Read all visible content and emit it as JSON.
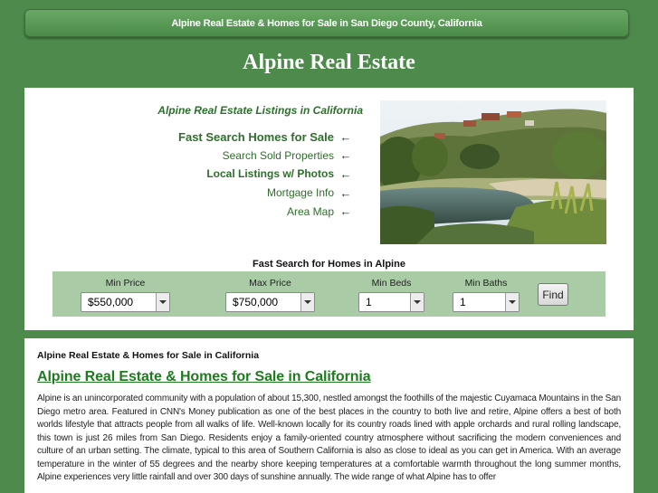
{
  "header": {
    "banner_text": "Alpine Real Estate & Homes for Sale in San Diego County, California",
    "site_title": "Alpine Real Estate"
  },
  "hero": {
    "listing_heading": "Alpine Real Estate Listings in California",
    "nav_links": [
      {
        "label": "Fast Search Homes for Sale",
        "icon": "arrow-left-icon"
      },
      {
        "label": "Search Sold Properties",
        "icon": "arrow-left-icon"
      },
      {
        "label": "Local Listings w/ Photos",
        "icon": "arrow-left-icon"
      },
      {
        "label": "Mortgage Info",
        "icon": "arrow-left-icon"
      },
      {
        "label": "Area Map",
        "icon": "arrow-left-icon"
      }
    ]
  },
  "search": {
    "title": "Fast Search for Homes in Alpine",
    "min_price": {
      "label": "Min Price",
      "value": "$550,000"
    },
    "max_price": {
      "label": "Max Price",
      "value": "$750,000"
    },
    "min_beds": {
      "label": "Min Beds",
      "value": "1"
    },
    "min_baths": {
      "label": "Min Baths",
      "value": "1"
    },
    "find_label": "Find"
  },
  "content": {
    "crumb_heading": "Alpine Real Estate & Homes for Sale in California",
    "main_heading": "Alpine Real Estate & Homes for Sale in California",
    "body": "Alpine is an unincorporated community with a population of about 15,300, nestled amongst the foothills of the majestic Cuyamaca Mountains in the San Diego metro area. Featured in CNN's Money publication as one of the best places in the country to both live and retire, Alpine offers a best of both worlds lifestyle that attracts people from all walks of life. Well-known locally for its country roads lined with apple orchards and rural rolling landscape, this town is just 26 miles from San Diego. Residents enjoy a family-oriented country atmosphere without sacrificing the modern conveniences and culture of an urban setting. The climate, typical to this area of Southern California is also as close to ideal as you can get in America. With an average temperature in the winter of 55 degrees and the nearby shore keeping temperatures at a comfortable warmth throughout the long summer months, Alpine experiences very little rainfall and over 300 days of sunshine annually. The wide range of what Alpine has to offer"
  },
  "colors": {
    "page_background": "#4d8a4b",
    "link_green": "#2e6e2b",
    "search_bar": "#a9cca6"
  }
}
